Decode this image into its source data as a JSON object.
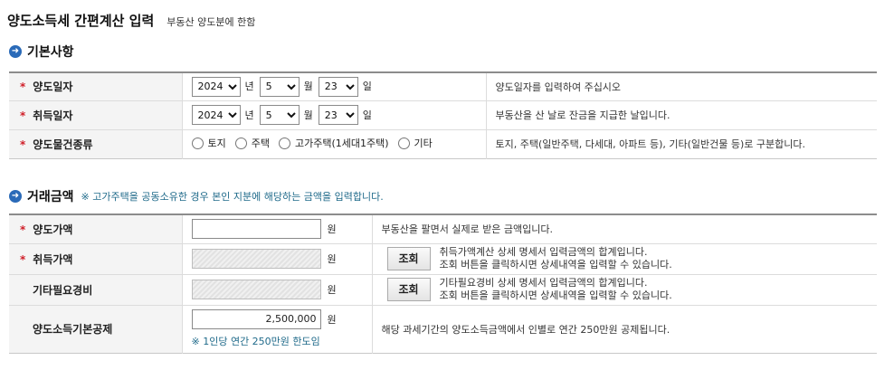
{
  "header": {
    "title": "양도소득세 간편계산 입력",
    "subtitle": "부동산 양도분에 한함"
  },
  "sections": {
    "basic": {
      "title": "기본사항",
      "icon": "circle-arrow-icon"
    },
    "amount": {
      "title": "거래금액",
      "note": "※ 고가주택을 공동소유한 경우 본인 지분에 해당하는 금액을 입력합니다.",
      "icon": "circle-arrow-icon"
    }
  },
  "units": {
    "year": "년",
    "month": "월",
    "day": "일",
    "won": "원"
  },
  "basic": {
    "transfer_date": {
      "label": "양도일자",
      "year": "2024",
      "month": "5",
      "day": "23",
      "desc": "양도일자를 입력하여 주십시오"
    },
    "acquire_date": {
      "label": "취득일자",
      "year": "2024",
      "month": "5",
      "day": "23",
      "desc": "부동산을 산 날로 잔금을 지급한 날입니다."
    },
    "property_type": {
      "label": "양도물건종류",
      "options": [
        "토지",
        "주택",
        "고가주택(1세대1주택)",
        "기타"
      ],
      "desc": "토지, 주택(일반주택, 다세대, 아파트 등), 기타(일반건물 등)로 구분합니다."
    }
  },
  "amount": {
    "transfer_price": {
      "label": "양도가액",
      "value": "",
      "desc": "부동산을 팔면서 실제로 받은 금액입니다."
    },
    "acquire_price": {
      "label": "취득가액",
      "value": "",
      "button": "조회",
      "desc1": "취득가액계산 상세 명세서 입력금액의 합계입니다.",
      "desc2": "조회 버튼을 클릭하시면 상세내역을 입력할 수 있습니다."
    },
    "other_expenses": {
      "label": "기타필요경비",
      "value": "",
      "button": "조회",
      "desc1": "기타필요경비 상세 명세서 입력금액의 합계입니다.",
      "desc2": "조회 버튼을 클릭하시면 상세내역을 입력할 수 있습니다."
    },
    "basic_deduction": {
      "label": "양도소득기본공제",
      "value": "2,500,000",
      "note": "※ 1인당 연간 250만원 한도임",
      "desc": "해당 과세기간의 양도소득금액에서 인별로 연간 250만원 공제됩니다."
    }
  },
  "colors": {
    "required": "#d0202a",
    "accent": "#2a6ab8",
    "note": "#1f6a8a"
  }
}
